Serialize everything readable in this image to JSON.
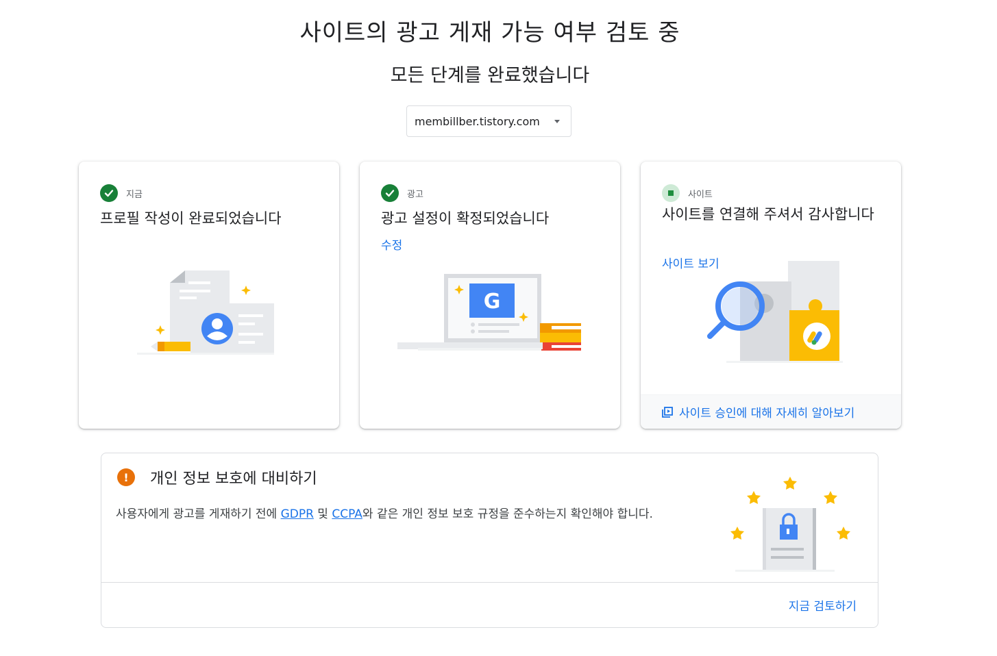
{
  "page": {
    "title": "사이트의 광고 게재 가능 여부 검토 중",
    "subtitle": "모든 단계를 완료했습니다"
  },
  "site_selector": {
    "value": "membillber.tistory.com"
  },
  "cards": [
    {
      "status_label": "지금",
      "status": "complete",
      "heading": "프로필 작성이 완료되었습니다"
    },
    {
      "status_label": "광고",
      "status": "complete",
      "heading": "광고 설정이 확정되었습니다",
      "link": "수정"
    },
    {
      "status_label": "사이트",
      "status": "in-progress",
      "heading": "사이트를 연결해 주셔서 감사합니다",
      "link": "사이트 보기",
      "footer_link": "사이트 승인에 대해 자세히 알아보기"
    }
  ],
  "privacy": {
    "title": "개인 정보 보호에 대비하기",
    "body_prefix": "사용자에게 광고를 게재하기 전에 ",
    "gdpr_link": "GDPR",
    "body_mid": " 및 ",
    "ccpa_link": "CCPA",
    "body_suffix": "와 같은 개인 정보 보호 규정을 준수하는지 확인해야 합니다.",
    "action": "지금 검토하기"
  },
  "colors": {
    "accent": "#1a73e8",
    "success": "#188038",
    "warning": "#e8710a",
    "star": "#fbbc04"
  }
}
